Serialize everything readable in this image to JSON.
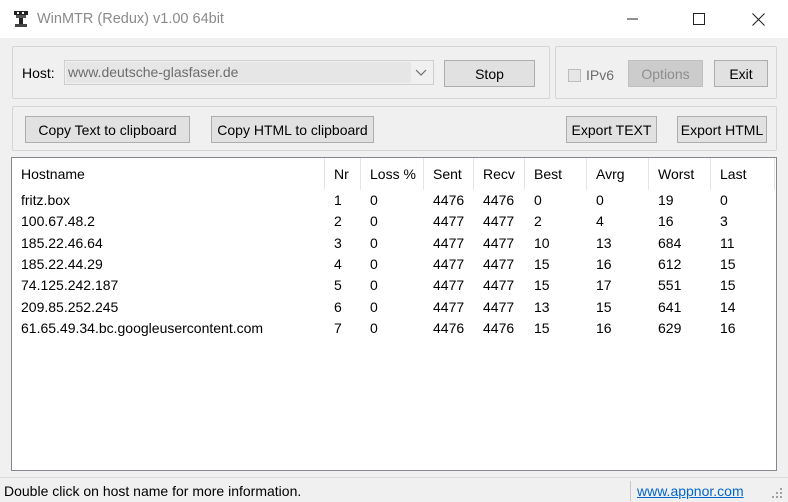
{
  "window": {
    "title": "WinMTR (Redux) v1.00 64bit",
    "icon": "winmtr-app-icon",
    "controls": [
      "minimize-icon",
      "maximize-icon",
      "close-icon"
    ]
  },
  "host": {
    "label": "Host:",
    "value": "www.deutsche-glasfaser.de",
    "stop_label": "Stop"
  },
  "options": {
    "ipv6_label": "IPv6",
    "ipv6_checked": false,
    "options_label": "Options",
    "exit_label": "Exit"
  },
  "toolbar": {
    "copy_text": "Copy Text to clipboard",
    "copy_html": "Copy HTML to clipboard",
    "export_text": "Export TEXT",
    "export_html": "Export HTML"
  },
  "table": {
    "columns": [
      "Hostname",
      "Nr",
      "Loss %",
      "Sent",
      "Recv",
      "Best",
      "Avrg",
      "Worst",
      "Last"
    ],
    "rows": [
      [
        "fritz.box",
        "1",
        "0",
        "4476",
        "4476",
        "0",
        "0",
        "19",
        "0"
      ],
      [
        "100.67.48.2",
        "2",
        "0",
        "4477",
        "4477",
        "2",
        "4",
        "16",
        "3"
      ],
      [
        "185.22.46.64",
        "3",
        "0",
        "4477",
        "4477",
        "10",
        "13",
        "684",
        "11"
      ],
      [
        "185.22.44.29",
        "4",
        "0",
        "4477",
        "4477",
        "15",
        "16",
        "612",
        "15"
      ],
      [
        "74.125.242.187",
        "5",
        "0",
        "4477",
        "4477",
        "15",
        "17",
        "551",
        "15"
      ],
      [
        "209.85.252.245",
        "6",
        "0",
        "4477",
        "4477",
        "13",
        "15",
        "641",
        "14"
      ],
      [
        "61.65.49.34.bc.googleusercontent.com",
        "7",
        "0",
        "4476",
        "4476",
        "15",
        "16",
        "629",
        "16"
      ]
    ]
  },
  "status": {
    "text": "Double click on host name for more information.",
    "link": "www.appnor.com"
  },
  "colors": {
    "link": "#0066cc",
    "window_bg": "#f0f0f0",
    "button_bg": "#e1e1e1"
  }
}
